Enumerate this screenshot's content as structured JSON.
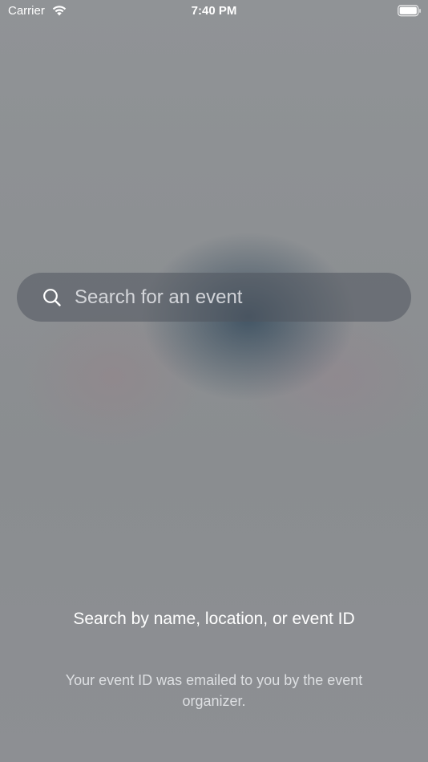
{
  "status_bar": {
    "carrier": "Carrier",
    "time": "7:40 PM",
    "wifi_icon": "wifi-icon",
    "battery_icon": "battery-icon"
  },
  "search": {
    "placeholder": "Search for an event",
    "value": "",
    "icon": "search-icon"
  },
  "hint": {
    "title": "Search by name, location, or event ID",
    "subtitle": "Your event ID was emailed to you by the event organizer."
  }
}
